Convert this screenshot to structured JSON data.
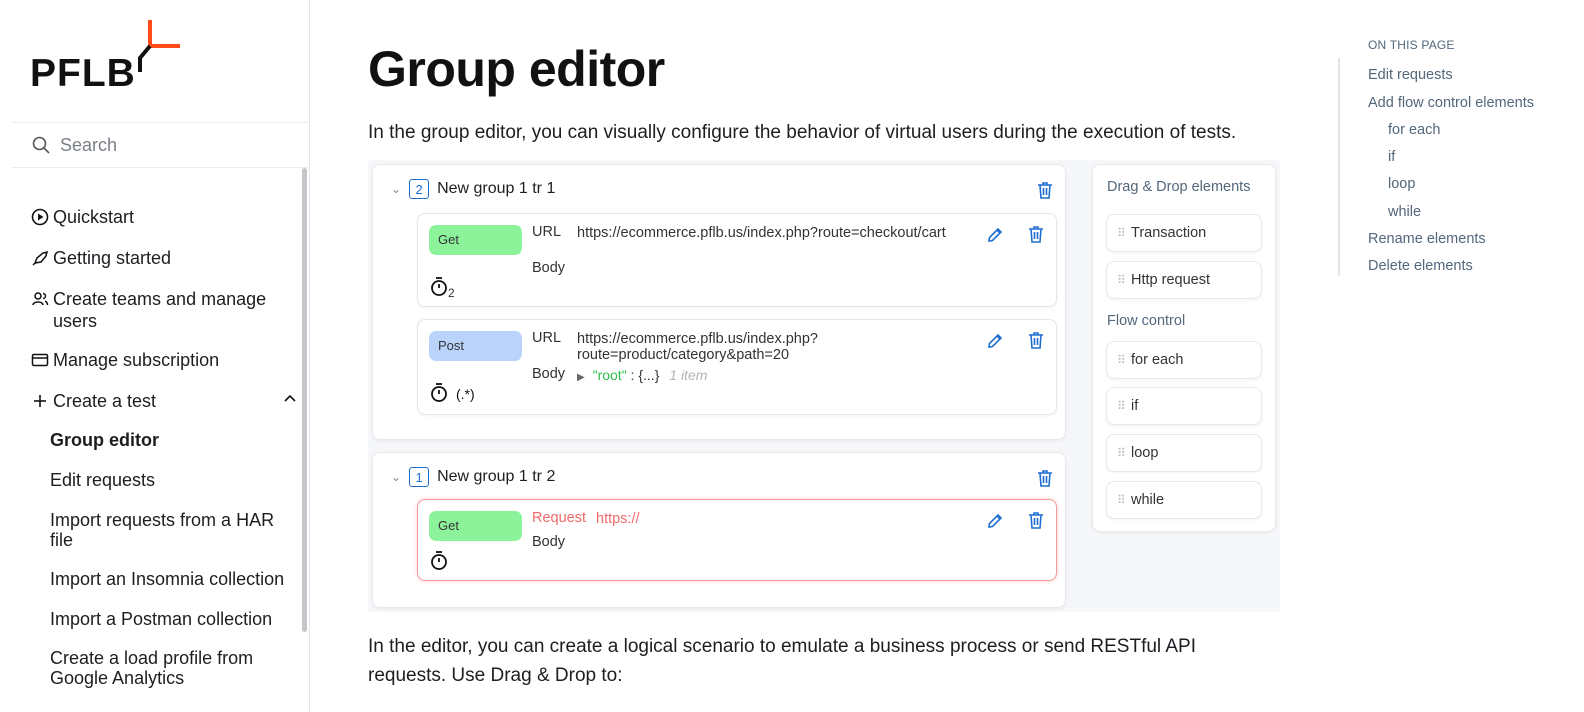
{
  "brand": {
    "logo_text": "PFLB",
    "accent": "#ff4a1c"
  },
  "search": {
    "placeholder": "Search"
  },
  "sidebar": {
    "items": [
      {
        "label": "Quickstart",
        "icon": "play-circle-icon"
      },
      {
        "label": "Getting started",
        "icon": "rocket-icon"
      },
      {
        "label": "Create teams and manage users",
        "icon": "users-icon"
      },
      {
        "label": "Manage subscription",
        "icon": "credit-card-icon"
      },
      {
        "label": "Create a test",
        "icon": "plus-icon",
        "expanded": true
      }
    ],
    "subitems": [
      {
        "label": "Group editor",
        "active": true
      },
      {
        "label": "Edit requests"
      },
      {
        "label": "Import requests from a HAR file"
      },
      {
        "label": "Import an Insomnia collection"
      },
      {
        "label": "Import a Postman collection"
      },
      {
        "label": "Create a load profile from Google Analytics"
      }
    ]
  },
  "main": {
    "title": "Group editor",
    "intro": "In the group editor, you can visually configure the behavior of virtual users during the execution of tests.",
    "outro": "In the editor, you can create a logical scenario to emulate a business process or send RESTful API requests. Use Drag & Drop to:"
  },
  "editor": {
    "groups": [
      {
        "count": "2",
        "name": "New group 1 tr 1",
        "requests": [
          {
            "method": "Get",
            "url_label": "URL",
            "url": "https://ecommerce.pflb.us/index.php?route=checkout/cart",
            "body_label": "Body",
            "body_value": "",
            "timer_sub": "2",
            "timer_text": ""
          },
          {
            "method": "Post",
            "url_label": "URL",
            "url": "https://ecommerce.pflb.us/index.php?route=product/category&path=20",
            "body_label": "Body",
            "body_root_key": "\"root\"",
            "body_sep": " : ",
            "body_obj": "{...}",
            "body_count": "1 item",
            "timer_sub": "",
            "timer_text": "(.*)"
          }
        ]
      },
      {
        "count": "1",
        "name": "New group 1 tr 2",
        "requests": [
          {
            "method": "Get",
            "url_label": "Request",
            "url": "https://",
            "body_label": "Body",
            "error": true
          }
        ]
      }
    ],
    "panel": {
      "dnd_title": "Drag & Drop elements",
      "dnd_items": [
        "Transaction",
        "Http request"
      ],
      "flow_title": "Flow control",
      "flow_items": [
        "for each",
        "if",
        "loop",
        "while"
      ]
    },
    "colors": {
      "get": "#8df39a",
      "post": "#b9d3fb",
      "link": "#1f6fd1",
      "error": "#f06a6a",
      "json_key": "#2fbf4a"
    }
  },
  "toc": {
    "title": "ON THIS PAGE",
    "items": [
      "Edit requests",
      "Add flow control elements",
      "for each",
      "if",
      "loop",
      "while",
      "Rename elements",
      "Delete elements"
    ]
  }
}
